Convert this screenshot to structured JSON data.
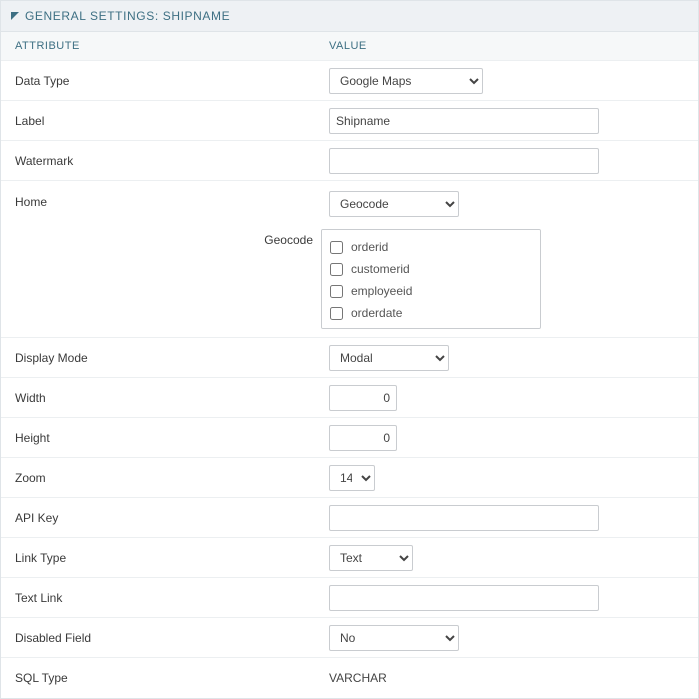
{
  "header": {
    "title": "GENERAL SETTINGS: SHIPNAME"
  },
  "columns": {
    "attribute": "ATTRIBUTE",
    "value": "VALUE"
  },
  "rows": {
    "dataType": {
      "label": "Data Type",
      "value": "Google Maps"
    },
    "label": {
      "label": "Label",
      "value": "Shipname"
    },
    "watermark": {
      "label": "Watermark",
      "value": ""
    },
    "home": {
      "label": "Home",
      "value": "Geocode",
      "geocode_label": "Geocode",
      "options": [
        "orderid",
        "customerid",
        "employeeid",
        "orderdate"
      ]
    },
    "displayMode": {
      "label": "Display Mode",
      "value": "Modal"
    },
    "width": {
      "label": "Width",
      "value": "0"
    },
    "height": {
      "label": "Height",
      "value": "0"
    },
    "zoom": {
      "label": "Zoom",
      "value": "14"
    },
    "apiKey": {
      "label": "API Key",
      "value": ""
    },
    "linkType": {
      "label": "Link Type",
      "value": "Text"
    },
    "textLink": {
      "label": "Text Link",
      "value": ""
    },
    "disabledField": {
      "label": "Disabled Field",
      "value": "No"
    },
    "sqlType": {
      "label": "SQL Type",
      "value": "VARCHAR"
    }
  }
}
